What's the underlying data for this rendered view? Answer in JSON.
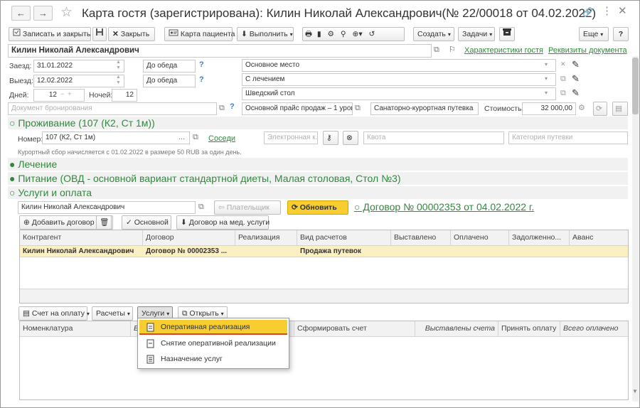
{
  "window": {
    "title": "Карта гостя (зарегистрирована): Килин Николай Александрович(№ 22/00018 от 04.02.2022)"
  },
  "toolbar": {
    "save_close": "Записать и закрыть",
    "close": "Закрыть",
    "patient_card": "Карта пациента",
    "execute": "Выполнить",
    "create": "Создать",
    "tasks": "Задачи",
    "more": "Еще",
    "help": "?"
  },
  "guest_name": "Килин Николай Александрович",
  "links": {
    "characteristics": "Характеристики гостя",
    "requisites": "Реквизиты документа"
  },
  "checkin": {
    "label": "Заезд:",
    "date": "31.01.2022",
    "time": "До обеда"
  },
  "checkout": {
    "label": "Выезд:",
    "date": "12.02.2022",
    "time": "До обеда"
  },
  "days": {
    "label": "Дней:",
    "value": "12"
  },
  "nights": {
    "label": "Ночей:",
    "value": "12"
  },
  "right_fields": {
    "place": "Основное место",
    "treatment": "С лечением",
    "table": "Шведский стол"
  },
  "booking_placeholder": "Документ бронирования",
  "price_type": "Основной прайс продаж – 1 уровен",
  "voucher": "Санаторно-курортная путевка",
  "cost": {
    "label": "Стоимость:",
    "value": "32 000,00"
  },
  "accommodation": {
    "header": "○ Проживание (107 (К2, Ст 1м))",
    "room_label": "Номер:",
    "room_value": "107 (К2, Ст 1м)",
    "neighbors": "Соседи",
    "ekey_placeholder": "Электронная к...",
    "quota_placeholder": "Квота",
    "category_placeholder": "Категория путевки",
    "resort_fee": "Курортный сбор начисляется с 01.02.2022 в размере 50 RUB за один день."
  },
  "sections": {
    "treatment": "● Лечение",
    "food": "● Питание (ОВД - основной вариант стандартной диеты, Малая столовая, Стол №3)",
    "services": "○ Услуги и оплата"
  },
  "services": {
    "payer_value": "Килин Николай Александрович",
    "payer_button": "Плательщик",
    "refresh_button": "Обновить",
    "contract_link": "○ Договор № 00002353 от 04.02.2022 г.",
    "add_contract": "Добавить договор",
    "main": "Основной",
    "med_contract": "Договор на мед. услуги"
  },
  "contracts_table": {
    "columns": [
      "Контрагент",
      "Договор",
      "Реализация",
      "Вид расчетов",
      "Выставлено",
      "Оплачено",
      "Задолженно...",
      "Аванс"
    ],
    "rows": [
      [
        "Килин Николай Александрович",
        "Договор № 00002353 ...",
        "",
        "Продажа путевок",
        "",
        "",
        "",
        ""
      ]
    ]
  },
  "bottom_toolbar": {
    "invoice": "Счет на оплату",
    "settlements": "Расчеты",
    "services": "Услуги",
    "open": "Открыть"
  },
  "services_table": {
    "columns": [
      "Номенклатура",
      "В",
      "Сформировать счет",
      "Выставлены счета",
      "Принять оплату",
      "Всего оплачено"
    ]
  },
  "dropdown_menu": {
    "items": [
      "Оперативная реализация",
      "Снятие оперативной реализации",
      "Назначение услуг"
    ]
  },
  "colors": {
    "accent_green": "#2f8a3c",
    "highlight_yellow": "#fbe48a",
    "selected_row": "#faf0c4",
    "menu_selected": "#f7cd2f"
  }
}
